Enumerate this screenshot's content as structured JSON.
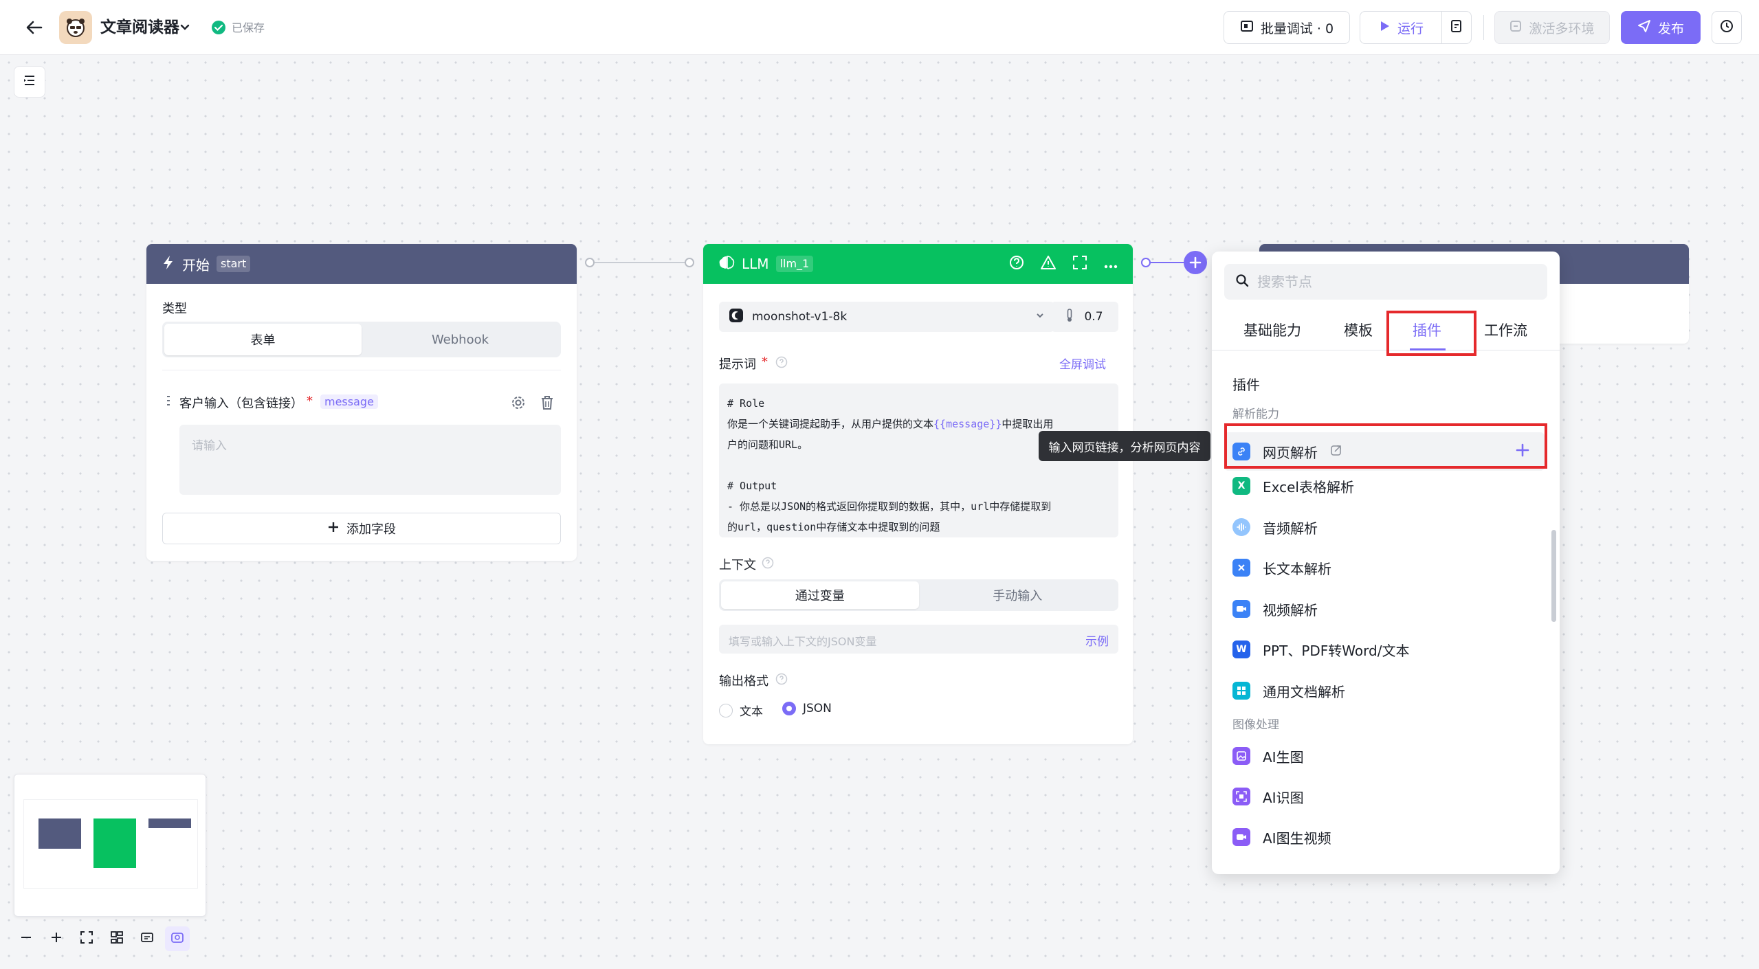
{
  "header": {
    "app_title": "文章阅读器",
    "saved_text": "已保存",
    "batch_debug_label": "批量调试 · 0",
    "run_label": "运行",
    "env_label": "激活多环境",
    "publish_label": "发布"
  },
  "start_node": {
    "title": "开始",
    "tag": "start",
    "type_label": "类型",
    "type_options": [
      "表单",
      "Webhook"
    ],
    "field_label": "客户输入（包含链接）",
    "field_required": "*",
    "field_var": "message",
    "input_placeholder": "请输入",
    "add_field_label": "添加字段"
  },
  "llm_node": {
    "title": "LLM",
    "tag": "llm_1",
    "model": "moonshot-v1-8k",
    "temperature": "0.7",
    "prompt_label": "提示词",
    "prompt_required": "*",
    "fullscreen_label": "全屏调试",
    "prompt_line1": "# Role",
    "prompt_line2_a": "你是一个关键词提起助手，从用户提供的文本",
    "prompt_var": "{{message}}",
    "prompt_line2_b": "中提取出用",
    "prompt_line3": "户的问题和URL。",
    "prompt_line5": "# Output",
    "prompt_line6": "- 你总是以JSON的格式返回你提取到的数据，其中，url中存储提取到",
    "prompt_line7": "的url，question中存储文本中提取到的问题",
    "context_label": "上下文",
    "context_options": [
      "通过变量",
      "手动输入"
    ],
    "context_placeholder": "填写或输入上下文的JSON变量",
    "example_label": "示例",
    "output_format_label": "输出格式",
    "format_options": [
      "文本",
      "JSON"
    ]
  },
  "panel": {
    "search_placeholder": "搜索节点",
    "tabs": [
      "基础能力",
      "模板",
      "插件",
      "工作流"
    ],
    "section_title": "插件",
    "group1": "解析能力",
    "group2": "图像处理",
    "items": [
      {
        "label": "网页解析",
        "icon": "link-icon",
        "color": "#3b82f6"
      },
      {
        "label": "Excel表格解析",
        "icon": "excel-icon",
        "color": "#10b981"
      },
      {
        "label": "音频解析",
        "icon": "audio-icon",
        "color": "#60a5fa"
      },
      {
        "label": "长文本解析",
        "icon": "document-icon",
        "color": "#3b82f6"
      },
      {
        "label": "视频解析",
        "icon": "video-icon",
        "color": "#3b82f6"
      },
      {
        "label": "PPT、PDF转Word/文本",
        "icon": "word-icon",
        "color": "#2563eb"
      },
      {
        "label": "通用文档解析",
        "icon": "doc-grid-icon",
        "color": "#06b6d4"
      },
      {
        "label": "AI生图",
        "icon": "image-gen-icon",
        "color": "#8b5cf6"
      },
      {
        "label": "AI识图",
        "icon": "image-scan-icon",
        "color": "#8b5cf6"
      },
      {
        "label": "AI图生视频",
        "icon": "image-video-icon",
        "color": "#8b5cf6"
      }
    ],
    "tooltip": "输入网页链接，分析网页内容"
  },
  "colors": {
    "accent": "#7b6cf6",
    "llm_header": "#07c160",
    "start_header": "#535a7e",
    "highlight_box": "#e5292c"
  }
}
